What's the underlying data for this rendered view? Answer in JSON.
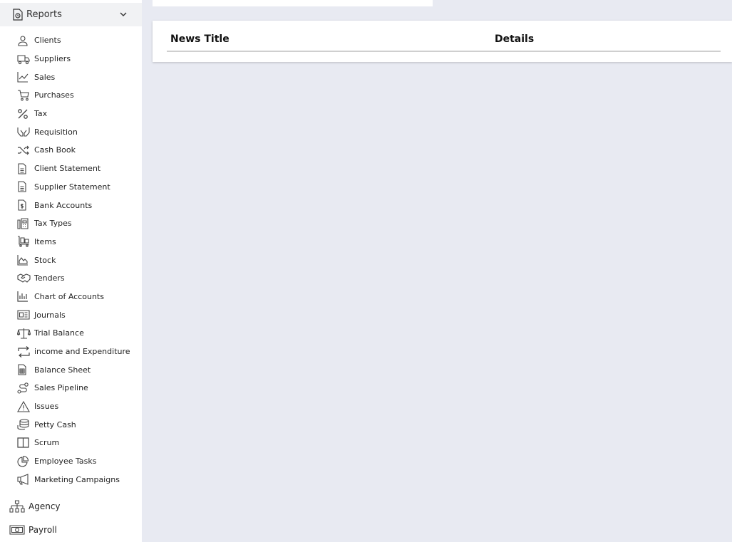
{
  "sidebar": {
    "section": {
      "label": "Reports",
      "icon": "report-clock-icon"
    },
    "items": [
      {
        "label": "Clients",
        "icon": "user-icon"
      },
      {
        "label": "Suppliers",
        "icon": "truck-icon"
      },
      {
        "label": "Sales",
        "icon": "line-chart-icon"
      },
      {
        "label": "Purchases",
        "icon": "cart-icon"
      },
      {
        "label": "Tax",
        "icon": "percent-icon"
      },
      {
        "label": "Requisition",
        "icon": "hands-icon"
      },
      {
        "label": "Cash Book",
        "icon": "shuffle-icon"
      },
      {
        "label": "Client Statement",
        "icon": "document-icon"
      },
      {
        "label": "Supplier Statement",
        "icon": "document-icon"
      },
      {
        "label": "Bank Accounts",
        "icon": "dollar-document-icon"
      },
      {
        "label": "Tax Types",
        "icon": "calculator-icon"
      },
      {
        "label": "Items",
        "icon": "cart-box-icon"
      },
      {
        "label": "Stock",
        "icon": "area-chart-icon"
      },
      {
        "label": "Tenders",
        "icon": "handshake-icon"
      },
      {
        "label": "Chart of Accounts",
        "icon": "bar-chart-icon"
      },
      {
        "label": "Journals",
        "icon": "newspaper-icon"
      },
      {
        "label": "Trial Balance",
        "icon": "scale-icon"
      },
      {
        "label": "income and Expenditure",
        "icon": "repeat-icon"
      },
      {
        "label": "Balance Sheet",
        "icon": "spreadsheet-icon"
      },
      {
        "label": "Sales Pipeline",
        "icon": "route-icon"
      },
      {
        "label": "Issues",
        "icon": "warning-icon"
      },
      {
        "label": "Petty Cash",
        "icon": "coins-icon"
      },
      {
        "label": "Scrum",
        "icon": "columns-icon"
      },
      {
        "label": "Employee Tasks",
        "icon": "pie-chart-icon"
      },
      {
        "label": "Marketing Campaigns",
        "icon": "megaphone-icon"
      }
    ],
    "agency": {
      "label": "Agency",
      "icon": "sitemap-icon"
    },
    "payroll": {
      "label": "Payroll",
      "icon": "money-bill-icon"
    }
  },
  "news_table": {
    "columns": [
      "News Title",
      "Details"
    ]
  }
}
